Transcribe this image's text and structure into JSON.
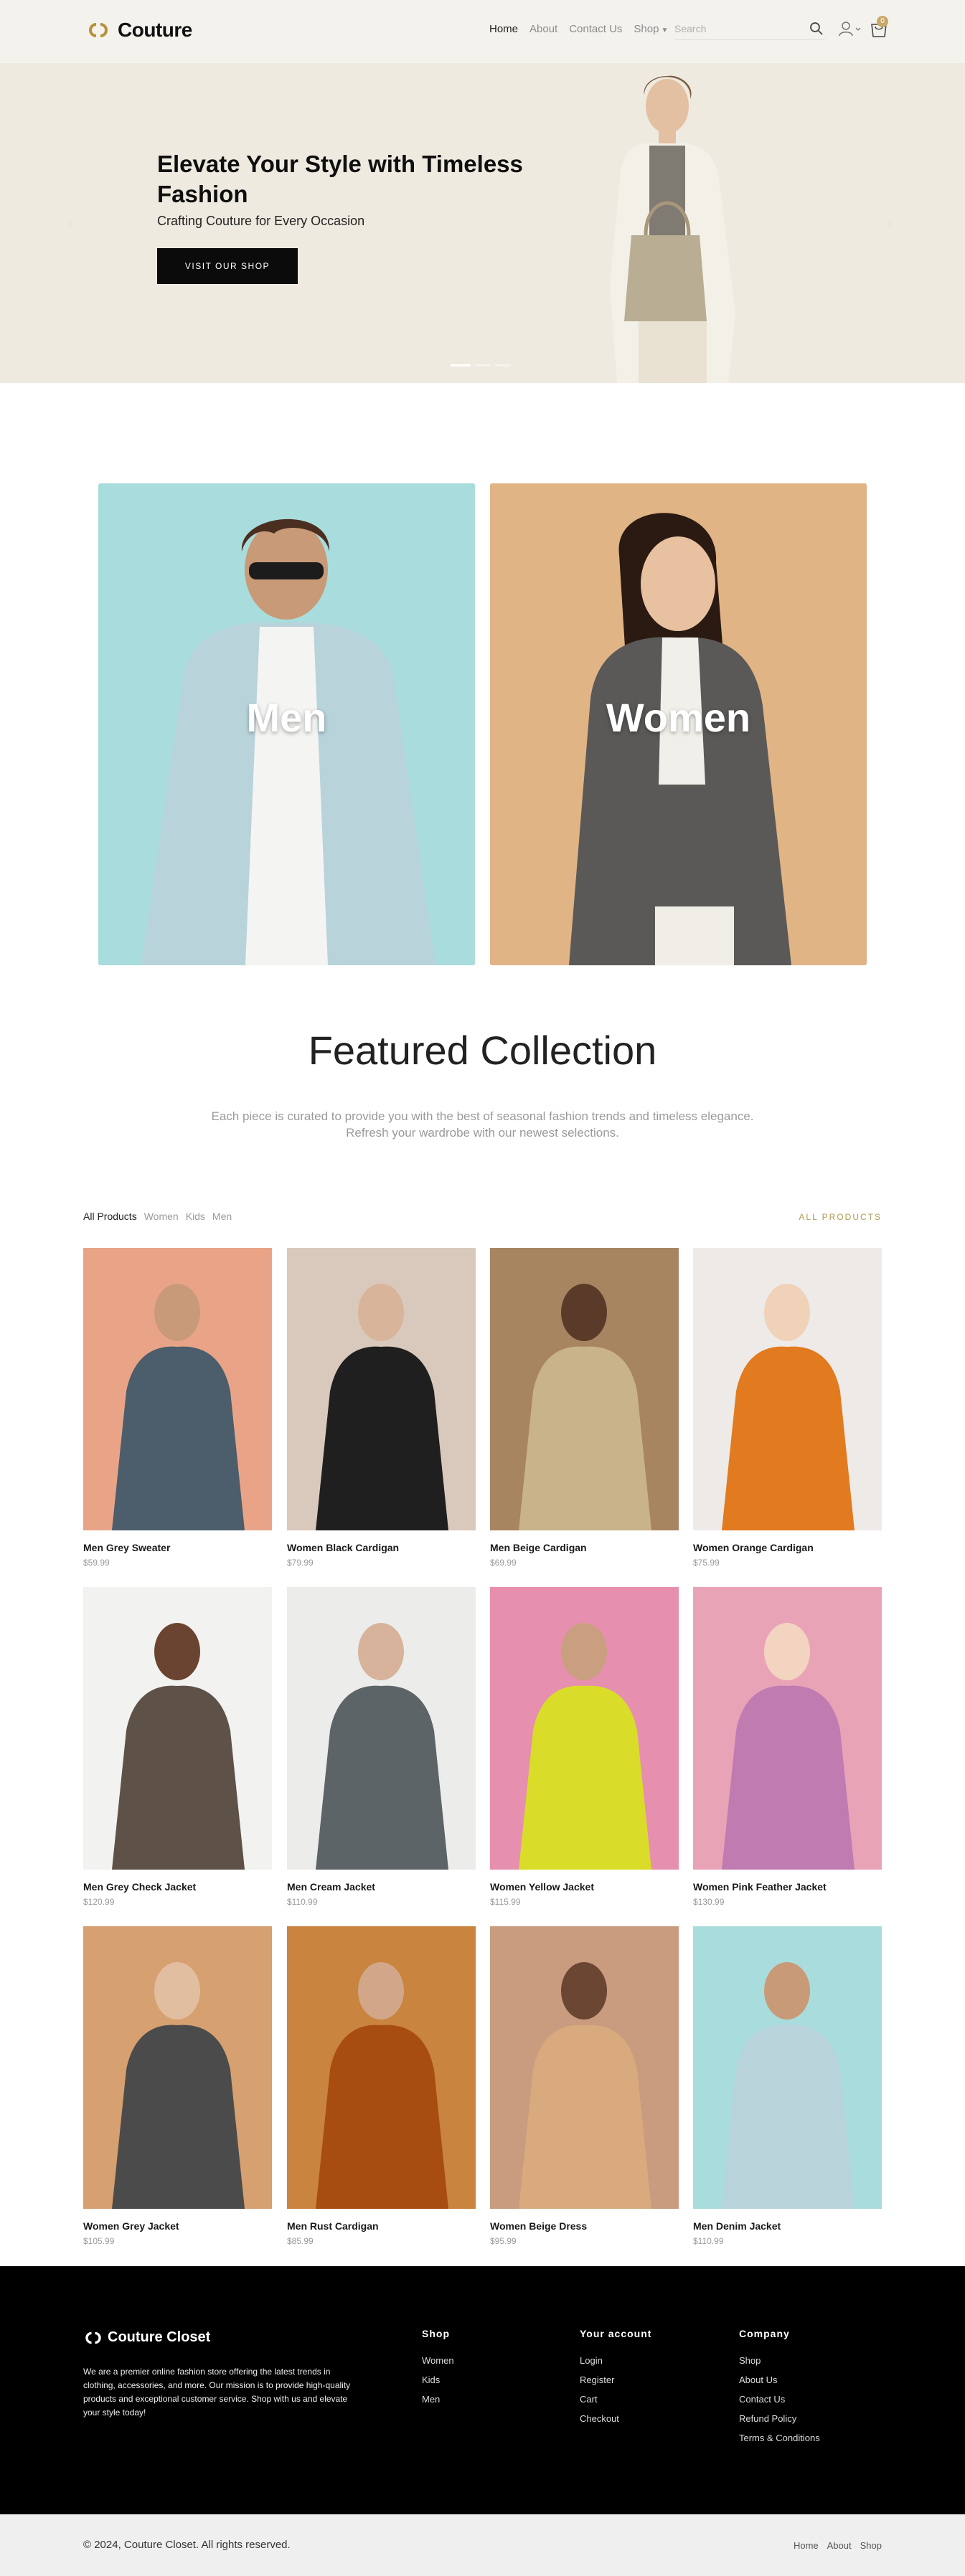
{
  "header": {
    "brand": "Couture",
    "nav": [
      {
        "label": "Home"
      },
      {
        "label": "About"
      },
      {
        "label": "Contact Us"
      },
      {
        "label": "Shop"
      }
    ],
    "search_placeholder": "Search",
    "cart_count": "0"
  },
  "hero": {
    "title": "Elevate Your Style with Timeless Fashion",
    "subtitle": "Crafting Couture for Every Occasion",
    "button": "VISIT OUR SHOP",
    "prev": "‹",
    "next": "›"
  },
  "categories": [
    {
      "label": "Men"
    },
    {
      "label": "Women"
    }
  ],
  "featured": {
    "title": "Featured Collection",
    "description": "Each piece is curated to provide you with the best of seasonal fashion trends and timeless elegance. Refresh your wardrobe with our newest selections.",
    "filters": [
      "All Products",
      "Women",
      "Kids",
      "Men"
    ],
    "all_products": "ALL PRODUCTS"
  },
  "products": [
    {
      "name": "Men Grey Sweater",
      "price": "$59.99"
    },
    {
      "name": "Women Black Cardigan",
      "price": "$79.99"
    },
    {
      "name": "Men Beige Cardigan",
      "price": "$69.99"
    },
    {
      "name": "Women Orange Cardigan",
      "price": "$75.99"
    },
    {
      "name": "Men Grey Check Jacket",
      "price": "$120.99"
    },
    {
      "name": "Men Cream Jacket",
      "price": "$110.99"
    },
    {
      "name": "Women Yellow Jacket",
      "price": "$115.99"
    },
    {
      "name": "Women Pink Feather Jacket",
      "price": "$130.99"
    },
    {
      "name": "Women Grey Jacket",
      "price": "$105.99"
    },
    {
      "name": "Men Rust Cardigan",
      "price": "$85.99"
    },
    {
      "name": "Women Beige Dress",
      "price": "$95.99"
    },
    {
      "name": "Men Denim Jacket",
      "price": "$110.99"
    }
  ],
  "footer": {
    "brand": "Couture Closet",
    "about": "We are a premier online fashion store offering the latest trends in clothing, accessories, and more. Our mission is to provide high-quality products and exceptional customer service. Shop with us and elevate your style today!",
    "shop": {
      "title": "Shop",
      "links": [
        "Women",
        "Kids",
        "Men"
      ]
    },
    "account": {
      "title": "Your account",
      "links": [
        "Login",
        "Register",
        "Cart",
        "Checkout"
      ]
    },
    "company": {
      "title": "Company",
      "links": [
        "Shop",
        "About Us",
        "Contact Us",
        "Refund Policy",
        "Terms & Conditions"
      ]
    },
    "copyright": "© 2024, Couture Closet. All rights reserved.",
    "bottom_links": [
      "Home",
      "About",
      "Shop"
    ]
  },
  "colors": {
    "accent": "#c7a96a",
    "header_bg": "#f4f2ed",
    "hero_bg": "#eeeae0",
    "men_card": "#a9dcdc",
    "women_card": "#e1b486",
    "footer_bg": "#000000"
  },
  "icons": [
    "logo-icon",
    "search-icon",
    "user-icon",
    "cart-icon",
    "chevron-down-icon"
  ]
}
